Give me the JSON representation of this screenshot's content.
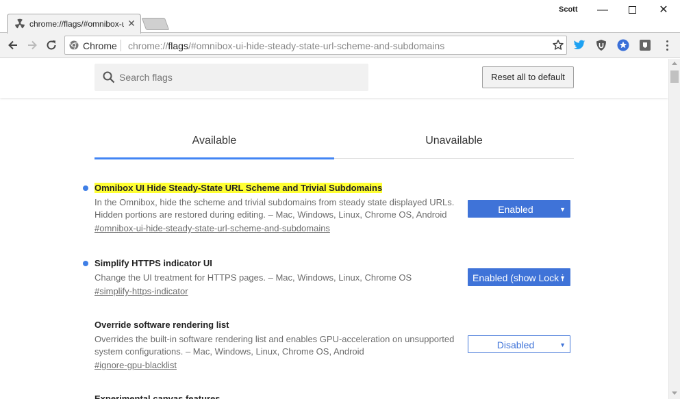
{
  "window": {
    "profile_name": "Scott",
    "minimize_glyph": "—",
    "close_glyph": "✕"
  },
  "tab": {
    "title": "chrome://flags/#omnibox-ui-hide-steady-state-url-scheme-and-subdomains",
    "close_glyph": "✕",
    "icon": "flags-radiation-icon"
  },
  "omnibox": {
    "chip_label": "Chrome",
    "url_scheme": "chrome://",
    "url_host": "flags",
    "url_path": "/#omnibox-ui-hide-steady-state-url-scheme-and-subdomains"
  },
  "extensions": [
    "twitter-icon",
    "ublock-shield-icon",
    "star-extension-icon",
    "pocket-icon"
  ],
  "search": {
    "placeholder": "Search flags",
    "value": ""
  },
  "reset_label": "Reset all to default",
  "tabs": [
    {
      "label": "Available",
      "selected": true
    },
    {
      "label": "Unavailable",
      "selected": false
    }
  ],
  "flags": [
    {
      "title": "Omnibox UI Hide Steady-State URL Scheme and Trivial Subdomains",
      "highlighted": true,
      "modified": true,
      "description": "In the Omnibox, hide the scheme and trivial subdomains from steady state displayed URLs. Hidden portions are restored during editing. – Mac, Windows, Linux, Chrome OS, Android",
      "link": "#omnibox-ui-hide-steady-state-url-scheme-and-subdomains",
      "selected_option": "Enabled"
    },
    {
      "title": "Simplify HTTPS indicator UI",
      "highlighted": false,
      "modified": true,
      "description": "Change the UI treatment for HTTPS pages. – Mac, Windows, Linux, Chrome OS",
      "link": "#simplify-https-indicator",
      "selected_option": "Enabled (show Lock i"
    },
    {
      "title": "Override software rendering list",
      "highlighted": false,
      "modified": false,
      "description": "Overrides the built-in software rendering list and enables GPU-acceleration on unsupported system configurations. – Mac, Windows, Linux, Chrome OS, Android",
      "link": "#ignore-gpu-blacklist",
      "selected_option": "Disabled"
    },
    {
      "title": "Experimental canvas features",
      "highlighted": false,
      "modified": false
    }
  ],
  "caret_glyph": "▼",
  "colors": {
    "accent_blue": "#3f73d8",
    "modified_dot": "#3f7fe6",
    "highlight_yellow": "#ffff33",
    "tab_underline": "#4285f4"
  }
}
